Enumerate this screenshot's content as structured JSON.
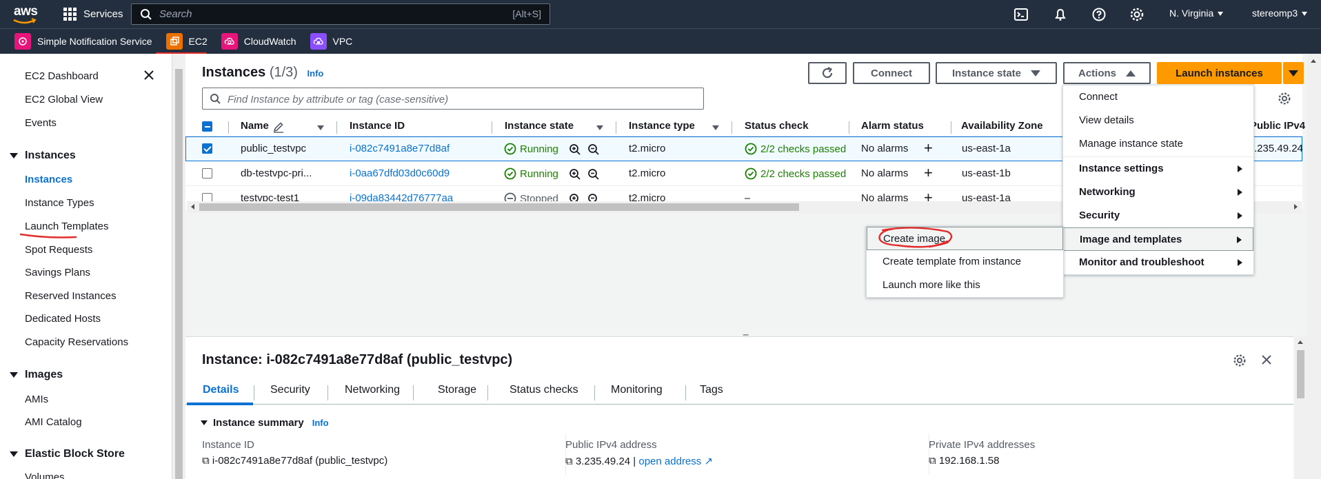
{
  "topnav": {
    "logo_text": "aws",
    "services_label": "Services",
    "search_placeholder": "Search",
    "search_shortcut": "[Alt+S]",
    "region": "N. Virginia",
    "user": "stereomp3"
  },
  "favorites": [
    {
      "label": "Simple Notification Service",
      "color": "#e7157b"
    },
    {
      "label": "EC2",
      "color": "#ed7100"
    },
    {
      "label": "CloudWatch",
      "color": "#e7157b"
    },
    {
      "label": "VPC",
      "color": "#8c4fff"
    }
  ],
  "sidebar": {
    "top_items": [
      "EC2 Dashboard",
      "EC2 Global View",
      "Events"
    ],
    "groups": [
      {
        "title": "Instances",
        "items": [
          "Instances",
          "Instance Types",
          "Launch Templates",
          "Spot Requests",
          "Savings Plans",
          "Reserved Instances",
          "Dedicated Hosts",
          "Capacity Reservations"
        ]
      },
      {
        "title": "Images",
        "items": [
          "AMIs",
          "AMI Catalog"
        ]
      },
      {
        "title": "Elastic Block Store",
        "items": [
          "Volumes"
        ]
      }
    ],
    "active_item": "Instances"
  },
  "panel": {
    "title": "Instances",
    "count": "(1/3)",
    "info": "Info",
    "buttons": {
      "connect": "Connect",
      "instance_state": "Instance state",
      "actions": "Actions",
      "launch": "Launch instances"
    },
    "filter_placeholder": "Find Instance by attribute or tag (case-sensitive)"
  },
  "table": {
    "columns": [
      "Name",
      "Instance ID",
      "Instance state",
      "Instance type",
      "Status check",
      "Alarm status",
      "Availability Zone",
      "Public IPv4"
    ],
    "rows": [
      {
        "selected": true,
        "name": "public_testvpc",
        "id": "i-082c7491a8e77d8af",
        "state": "Running",
        "type": "t2.micro",
        "status": "2/2 checks passed",
        "alarm": "No alarms",
        "az": "us-east-1a",
        "ip": ".235.49.24"
      },
      {
        "selected": false,
        "name": "db-testvpc-pri...",
        "id": "i-0aa67dfd03d0c60d9",
        "state": "Running",
        "type": "t2.micro",
        "status": "2/2 checks passed",
        "alarm": "No alarms",
        "az": "us-east-1b",
        "ip": ""
      },
      {
        "selected": false,
        "name": "testvpc-test1",
        "id": "i-09da83442d76777aa",
        "state": "Stopped",
        "type": "t2.micro",
        "status": "–",
        "alarm": "No alarms",
        "az": "us-east-1a",
        "ip": ""
      }
    ]
  },
  "actions_menu": [
    "Connect",
    "View details",
    "Manage instance state",
    "Instance settings",
    "Networking",
    "Security",
    "Image and templates",
    "Monitor and troubleshoot"
  ],
  "image_submenu": [
    "Create image",
    "Create template from instance",
    "Launch more like this"
  ],
  "detail": {
    "title": "Instance: i-082c7491a8e77d8af (public_testvpc)",
    "tabs": [
      "Details",
      "Security",
      "Networking",
      "Storage",
      "Status checks",
      "Monitoring",
      "Tags"
    ],
    "summary_title": "Instance summary",
    "summary_info": "Info",
    "fields": [
      {
        "label": "Instance ID",
        "value": "i-082c7491a8e77d8af (public_testvpc)",
        "link": ""
      },
      {
        "label": "Public IPv4 address",
        "value": "3.235.49.24",
        "link": "open address"
      },
      {
        "label": "Private IPv4 addresses",
        "value": "192.168.1.58",
        "link": ""
      }
    ]
  },
  "colors": {
    "accent": "#0972d3",
    "primary": "#ff9900",
    "nav": "#232f3e",
    "running": "#1d8102",
    "annotation": "#e12c2c"
  }
}
